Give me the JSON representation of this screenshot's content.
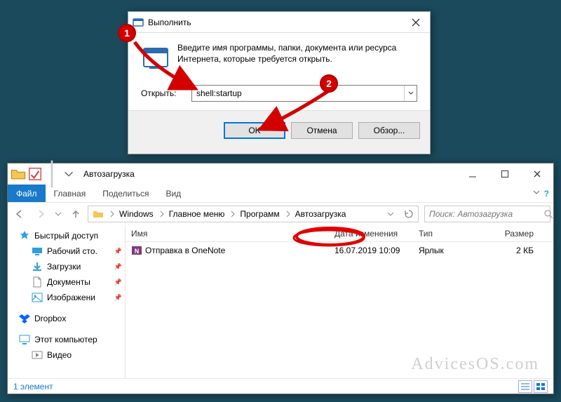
{
  "run_dialog": {
    "title": "Выполнить",
    "description": "Введите имя программы, папки, документа или ресурса Интернета, которые требуется открыть.",
    "open_label": "Открыть:",
    "input_value": "shell:startup",
    "buttons": {
      "ok": "OK",
      "cancel": "Отмена",
      "browse": "Обзор..."
    }
  },
  "markers": {
    "one": "1",
    "two": "2"
  },
  "explorer": {
    "title": "Автозагрузка",
    "tabs": {
      "file": "Файл",
      "home": "Главная",
      "share": "Поделиться",
      "view": "Вид"
    },
    "breadcrumb": [
      "Windows",
      "Главное меню",
      "Программ",
      "Автозагрузка"
    ],
    "search_placeholder": "Поиск: Автозагрузка",
    "columns": {
      "name": "Имя",
      "date": "Дата изменения",
      "type": "Тип",
      "size": "Размер"
    },
    "sidebar": {
      "quick": "Быстрый доступ",
      "desktop": "Рабочий сто.",
      "downloads": "Загрузки",
      "documents": "Документы",
      "pictures": "Изображени",
      "dropbox": "Dropbox",
      "thispc": "Этот компьютер",
      "videos": "Видео"
    },
    "file": {
      "name": "Отправка в OneNote",
      "date": "16.07.2019 10:09",
      "type": "Ярлык",
      "size": "2 КБ"
    },
    "status": "1 элемент"
  },
  "watermark": "AdvicesOS.com"
}
